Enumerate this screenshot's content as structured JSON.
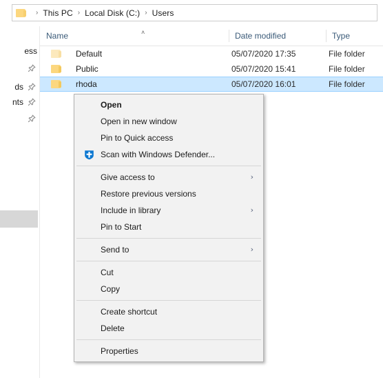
{
  "address_bar": {
    "icon": "folder-icon",
    "crumbs": [
      "This PC",
      "Local Disk (C:)",
      "Users"
    ],
    "separator": "›"
  },
  "nav_pane": {
    "items": [
      {
        "label": "ess",
        "icon": "",
        "pin": false
      },
      {
        "label": "",
        "icon": "pin-icon",
        "pin": true
      },
      {
        "label": "ds",
        "icon": "pin-icon",
        "pin": true
      },
      {
        "label": "nts",
        "icon": "pin-icon",
        "pin": true
      },
      {
        "label": "",
        "icon": "pin-icon",
        "pin": true
      }
    ]
  },
  "file_list": {
    "columns": [
      {
        "key": "name",
        "label": "Name",
        "sorted": "ascending",
        "sort_glyph": "˄"
      },
      {
        "key": "date",
        "label": "Date modified"
      },
      {
        "key": "type",
        "label": "Type"
      }
    ],
    "rows": [
      {
        "name": "Default",
        "date": "05/07/2020 17:35",
        "type": "File folder",
        "selected": false,
        "hidden_style": true
      },
      {
        "name": "Public",
        "date": "05/07/2020 15:41",
        "type": "File folder",
        "selected": false,
        "hidden_style": false
      },
      {
        "name": "rhoda",
        "date": "05/07/2020 16:01",
        "type": "File folder",
        "selected": true,
        "hidden_style": false
      }
    ]
  },
  "context_menu": {
    "items": [
      {
        "label": "Open",
        "bold": true,
        "icon": null,
        "submenu": false
      },
      {
        "label": "Open in new window",
        "bold": false,
        "icon": null,
        "submenu": false
      },
      {
        "label": "Pin to Quick access",
        "bold": false,
        "icon": null,
        "submenu": false
      },
      {
        "label": "Scan with Windows Defender...",
        "bold": false,
        "icon": "shield-icon",
        "submenu": false
      },
      {
        "separator": true
      },
      {
        "label": "Give access to",
        "bold": false,
        "icon": null,
        "submenu": true
      },
      {
        "label": "Restore previous versions",
        "bold": false,
        "icon": null,
        "submenu": false
      },
      {
        "label": "Include in library",
        "bold": false,
        "icon": null,
        "submenu": true
      },
      {
        "label": "Pin to Start",
        "bold": false,
        "icon": null,
        "submenu": false
      },
      {
        "separator": true
      },
      {
        "label": "Send to",
        "bold": false,
        "icon": null,
        "submenu": true
      },
      {
        "separator": true
      },
      {
        "label": "Cut",
        "bold": false,
        "icon": null,
        "submenu": false
      },
      {
        "label": "Copy",
        "bold": false,
        "icon": null,
        "submenu": false
      },
      {
        "separator": true
      },
      {
        "label": "Create shortcut",
        "bold": false,
        "icon": null,
        "submenu": false
      },
      {
        "label": "Delete",
        "bold": false,
        "icon": null,
        "submenu": false
      },
      {
        "separator": true
      },
      {
        "label": "Properties",
        "bold": false,
        "icon": null,
        "submenu": false
      }
    ],
    "submenu_arrow": "›"
  },
  "colors": {
    "selection_fill": "#cce8ff",
    "selection_border": "#99d1ff",
    "menu_background": "#f2f2f2",
    "menu_border": "#b3b3b3",
    "folder_yellow": "#fcd77f",
    "header_text": "#3a5a78",
    "defender_blue": "#0d78d1"
  }
}
